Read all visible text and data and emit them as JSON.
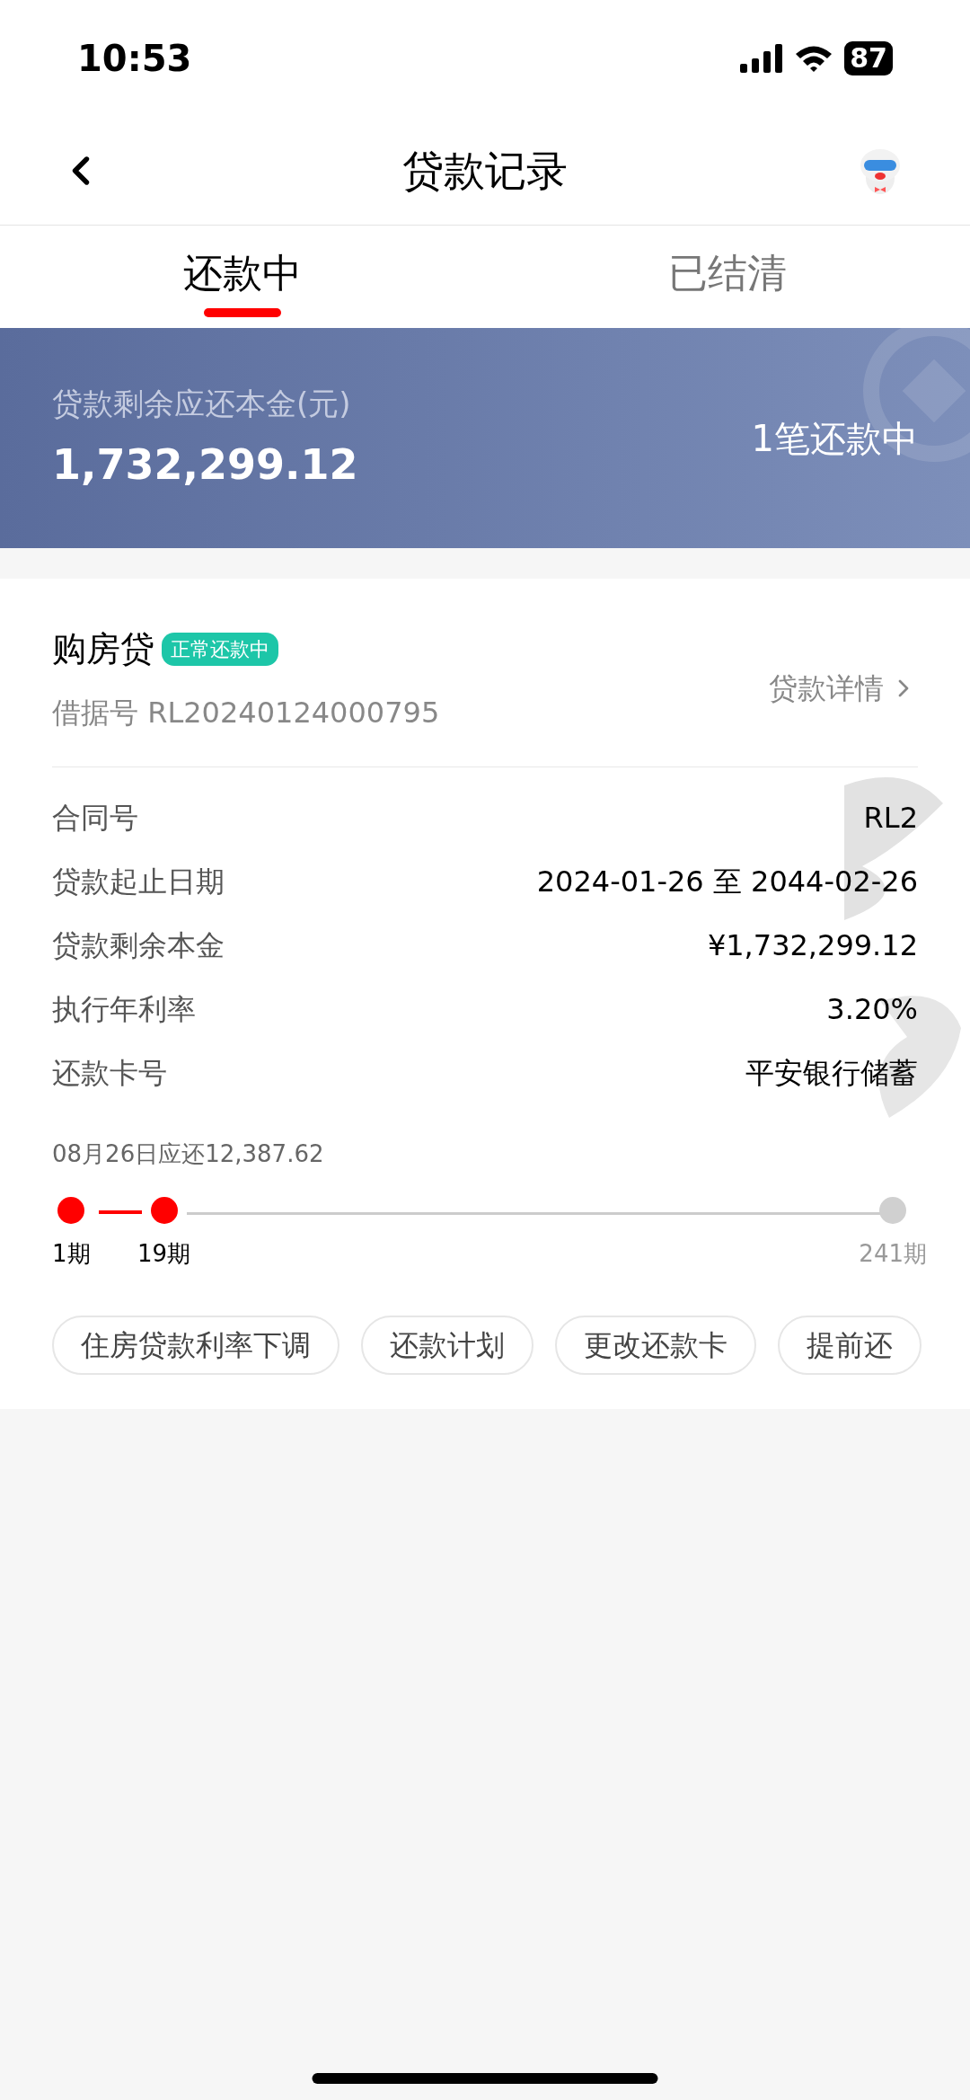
{
  "status_bar": {
    "time": "10:53",
    "battery": "87"
  },
  "nav": {
    "title": "贷款记录"
  },
  "tabs": [
    {
      "label": "还款中",
      "selected": true
    },
    {
      "label": "已结清",
      "selected": false
    }
  ],
  "summary": {
    "label": "贷款剩余应还本金(元)",
    "amount": "1,732,299.12",
    "count": "1笔还款中"
  },
  "loan": {
    "name": "购房贷",
    "status": "正常还款中",
    "receipt": "借据号 RL20240124000795",
    "detail_link": "贷款详情",
    "rows": [
      {
        "label": "合同号",
        "value": "RL2"
      },
      {
        "label": "贷款起止日期",
        "value": "2024-01-26 至 2044-02-26"
      },
      {
        "label": "贷款剩余本金",
        "value": "¥1,732,299.12"
      },
      {
        "label": "执行年利率",
        "value": "3.20%"
      },
      {
        "label": "还款卡号",
        "value": "平安银行储蓄"
      }
    ],
    "due": "08月26日应还12,387.62",
    "periods": [
      {
        "label": "1期",
        "reached": true
      },
      {
        "label": "19期",
        "reached": true
      },
      {
        "label": "241期",
        "reached": false
      }
    ],
    "actions": [
      "住房贷款利率下调",
      "还款计划",
      "更改还款卡",
      "提前还"
    ]
  }
}
